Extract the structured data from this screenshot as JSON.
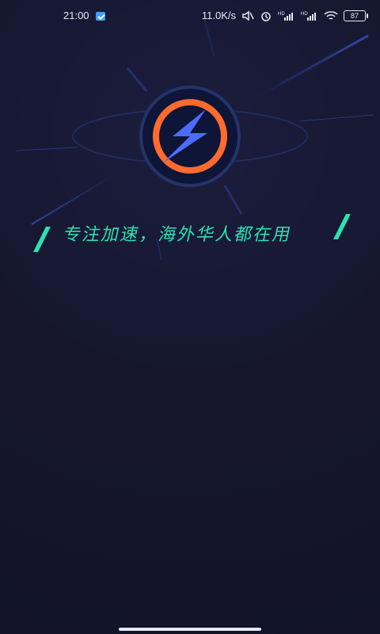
{
  "status_bar": {
    "time": "21:00",
    "network_speed": "11.0K/s",
    "battery_level": "87",
    "icons": [
      "notification-app-icon",
      "mute-icon",
      "alarm-icon",
      "signal-hd-icon",
      "signal-hd-icon",
      "wifi-icon",
      "battery-icon"
    ]
  },
  "splash": {
    "tagline": "专注加速，海外华人都在用",
    "colors": {
      "background": "#15162e",
      "accent_teal": "#2be3b1",
      "logo_blue": "#4b6cff",
      "logo_orange": "#ff6b2f",
      "ring_navy": "#0f1536"
    },
    "logo_icon": "lightning-bolt-in-orange-ring"
  }
}
